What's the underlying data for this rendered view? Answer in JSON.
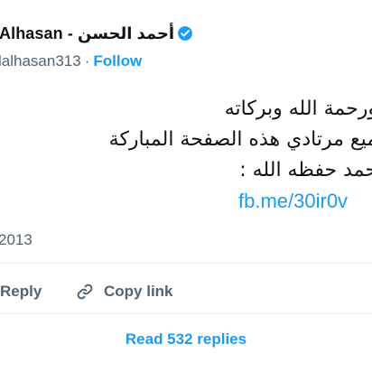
{
  "tweet": {
    "author_name": "Alhasan - أحمد الحسن",
    "handle": "lalhasan313",
    "separator": "·",
    "follow_label": "Follow",
    "body_lines": [
      "ورحمة الله وبركاته",
      "ميع مرتادي هذه الصفحة المباركة",
      "حمد حفظه الله :"
    ],
    "link_text": "fb.me/30ir0v",
    "date": "2013"
  },
  "actions": {
    "reply_label": "Reply",
    "copy_link_label": "Copy link"
  },
  "footer": {
    "read_replies_label": "Read 532 replies"
  },
  "colors": {
    "accent": "#1d9bf0",
    "text_primary": "#0f1419",
    "text_secondary": "#536471",
    "divider": "#eff3f4"
  },
  "icons": {
    "verified": "verified-badge-icon",
    "copy_link": "link-icon"
  }
}
